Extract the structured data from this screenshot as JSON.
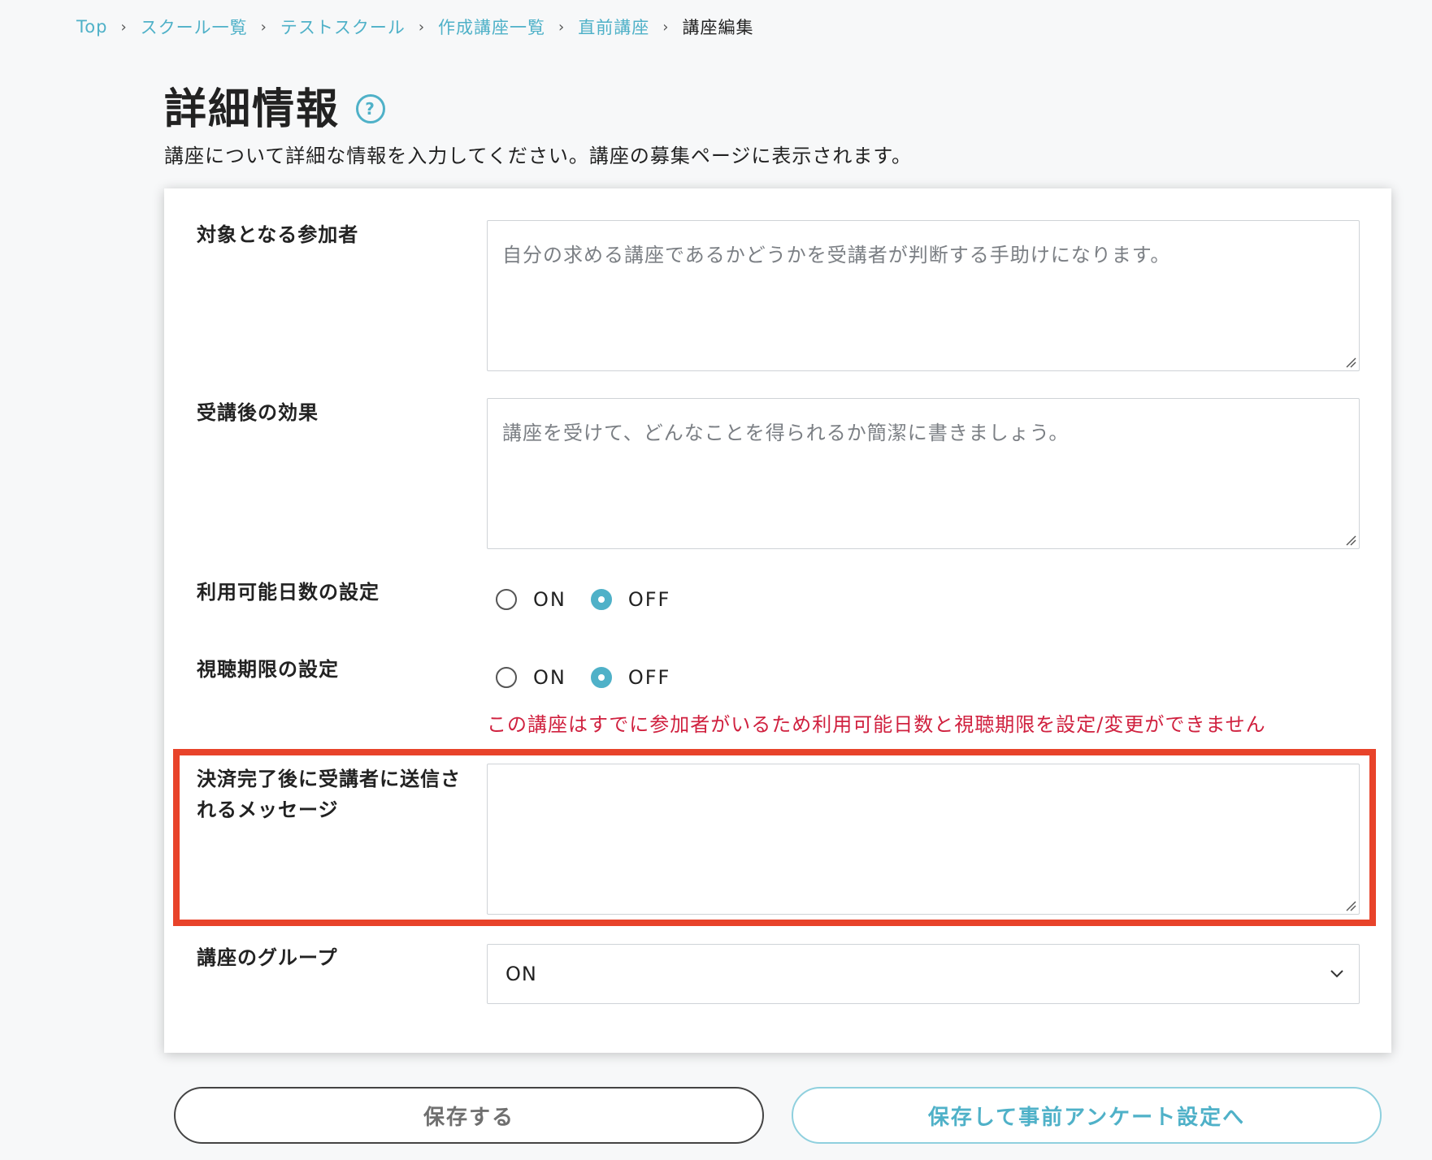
{
  "breadcrumb": {
    "items": [
      "Top",
      "スクール一覧",
      "テストスクール",
      "作成講座一覧",
      "直前講座"
    ],
    "current": "講座編集",
    "separator": "›"
  },
  "header": {
    "title": "詳細情報",
    "help_icon": "?",
    "subtitle": "講座について詳細な情報を入力してください。講座の募集ページに表示されます。"
  },
  "form": {
    "target_participants": {
      "label": "対象となる参加者",
      "placeholder": "自分の求める講座であるかどうかを受講者が判断する手助けになります。"
    },
    "effects": {
      "label": "受講後の効果",
      "placeholder": "講座を受けて、どんなことを得られるか簡潔に書きましょう。"
    },
    "available_days": {
      "label": "利用可能日数の設定",
      "options": [
        "ON",
        "OFF"
      ],
      "selected": "OFF"
    },
    "viewing_period": {
      "label": "視聴期限の設定",
      "options": [
        "ON",
        "OFF"
      ],
      "selected": "OFF"
    },
    "warning": "この講座はすでに参加者がいるため利用可能日数と視聴期限を設定/変更ができません",
    "payment_message": {
      "label_line1": "決済完了後に受講者に送信さ",
      "label_line2": "れるメッセージ",
      "value": ""
    },
    "group": {
      "label": "講座のグループ",
      "selected": "ON"
    }
  },
  "actions": {
    "save_label": "保存する",
    "save_next_label": "保存して事前アンケート設定へ"
  },
  "colors": {
    "accent": "#4fb1c8",
    "warning": "#d0213f",
    "highlight": "#e8432a"
  }
}
